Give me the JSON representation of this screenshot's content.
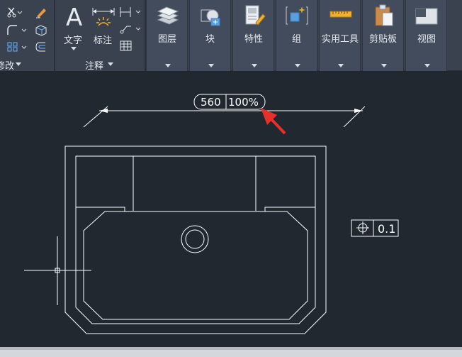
{
  "ribbon": {
    "modify_panel_title": "修改",
    "annotation_panel_title": "注释",
    "text_label": "文字",
    "dimension_label": "标注",
    "buttons": [
      {
        "label": "图层"
      },
      {
        "label": "块"
      },
      {
        "label": "特性"
      },
      {
        "label": "组"
      },
      {
        "label": "实用工具"
      },
      {
        "label": "剪贴板"
      },
      {
        "label": "视图"
      }
    ]
  },
  "drawing": {
    "dimension_value": "560",
    "dimension_scale": "100%",
    "tolerance_value": "0.1"
  },
  "colors": {
    "canvas_bg": "#212830",
    "ribbon_bg": "#3a4250",
    "line": "#ffffff",
    "arrow": "#e8302a"
  }
}
